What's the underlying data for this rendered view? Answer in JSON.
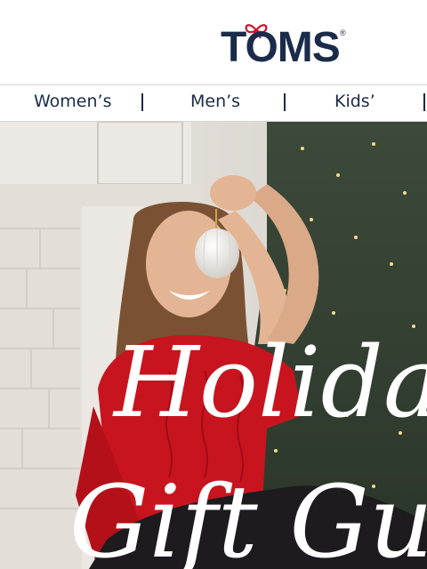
{
  "brand": {
    "name": "TOMS",
    "registered_mark": "®",
    "bow_icon": "red-bow-icon",
    "brand_color": "#1b2b4a",
    "accent_color": "#d4112b"
  },
  "nav": {
    "items": [
      {
        "label": "Women’s"
      },
      {
        "label": "Men’s"
      },
      {
        "label": "Kids’"
      }
    ]
  },
  "hero": {
    "headline_line1": "Holiday",
    "headline_line2": "Gift Guide",
    "image": "woman-in-red-sweater-with-ornament-by-christmas-tree"
  }
}
